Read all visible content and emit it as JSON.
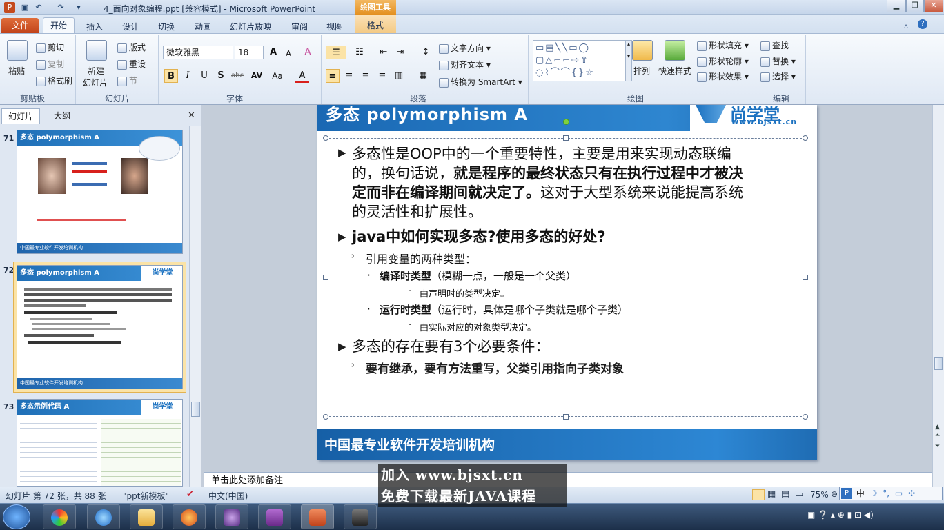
{
  "titlebar": {
    "title": "4_面向对象编程.ppt [兼容模式] - Microsoft PowerPoint",
    "context_tool": "绘图工具"
  },
  "tabs": {
    "file": "文件",
    "home": "开始",
    "insert": "插入",
    "design": "设计",
    "transitions": "切换",
    "animations": "动画",
    "slideshow": "幻灯片放映",
    "review": "审阅",
    "view": "视图",
    "format": "格式"
  },
  "ribbon": {
    "clipboard": {
      "label": "剪贴板",
      "paste": "粘贴",
      "cut": "剪切",
      "copy": "复制",
      "format_painter": "格式刷"
    },
    "slides": {
      "label": "幻灯片",
      "new_slide": "新建",
      "new_slide2": "幻灯片",
      "layout": "版式",
      "reset": "重设",
      "section": "节"
    },
    "font": {
      "label": "字体",
      "font_name": "微软雅黑",
      "font_size": "18",
      "grow": "A",
      "shrink": "A",
      "clear": "A",
      "bold": "B",
      "italic": "I",
      "underline": "U",
      "shadow": "S",
      "strike": "abc",
      "spacing": "AV",
      "case": "Aa",
      "color": "A"
    },
    "paragraph": {
      "label": "段落",
      "text_direction": "文字方向",
      "align_text": "对齐文本",
      "smartart": "转换为 SmartArt"
    },
    "drawing": {
      "label": "绘图",
      "arrange": "排列",
      "quick_styles": "快速样式",
      "fill": "形状填充",
      "outline": "形状轮廓",
      "effects": "形状效果"
    },
    "editing": {
      "label": "编辑",
      "find": "查找",
      "replace": "替换",
      "select": "选择"
    }
  },
  "left_pane": {
    "tab_slides": "幻灯片",
    "tab_outline": "大纲",
    "thumbs": [
      {
        "num": "71",
        "title": "多态 polymorphism  A",
        "footer": "中国最专业软件开发培训机构"
      },
      {
        "num": "72",
        "title": "多态 polymorphism  A",
        "footer": "中国最专业软件开发培训机构",
        "logo": "尚学堂"
      },
      {
        "num": "73",
        "title": "多态示例代码 A",
        "logo": "尚学堂"
      }
    ]
  },
  "slide": {
    "title": "多态 polymorphism  A",
    "logo": "尚学堂",
    "logo_url": "www.bjsxt.cn",
    "footer": "中国最专业软件开发培训机构",
    "p1_line1": "多态性是OOP中的一个重要特性，主要是用来实现动态联编",
    "p1_line2_a": "的，换句话说，",
    "p1_line2_b": "就是程序的最终状态只有在执行过程中才被决",
    "p1_line3_a": "定而非在编译期间就决定了。",
    "p1_line3_b": "这对于大型系统来说能提高系统",
    "p1_line4": "的灵活性和扩展性。",
    "p2": "java中如何实现多态?使用多态的好处?",
    "p2_sub": "引用变量的两种类型：",
    "compile_bold": "编译时类型",
    "compile_rest": "（模糊一点，一般是一个父类）",
    "compile_sub": "由声明时的类型决定。",
    "runtime_bold": "运行时类型",
    "runtime_rest": "（运行时，具体是哪个子类就是哪个子类）",
    "runtime_sub": "由实际对应的对象类型决定。",
    "p3": "多态的存在要有3个必要条件：",
    "p3_sub": "要有继承，要有方法重写，父类引用指向子类对象"
  },
  "notes": {
    "placeholder": "单击此处添加备注"
  },
  "statusbar": {
    "slide_info": "幻灯片 第 72 张，共 88 张",
    "theme": "\"ppt新模板\"",
    "language": "中文(中国)",
    "zoom": "75%"
  },
  "watermark": {
    "line1": "加入 www.bjsxt.cn",
    "line2": "免费下载最新JAVA课程"
  },
  "ime": {
    "label": "中"
  }
}
